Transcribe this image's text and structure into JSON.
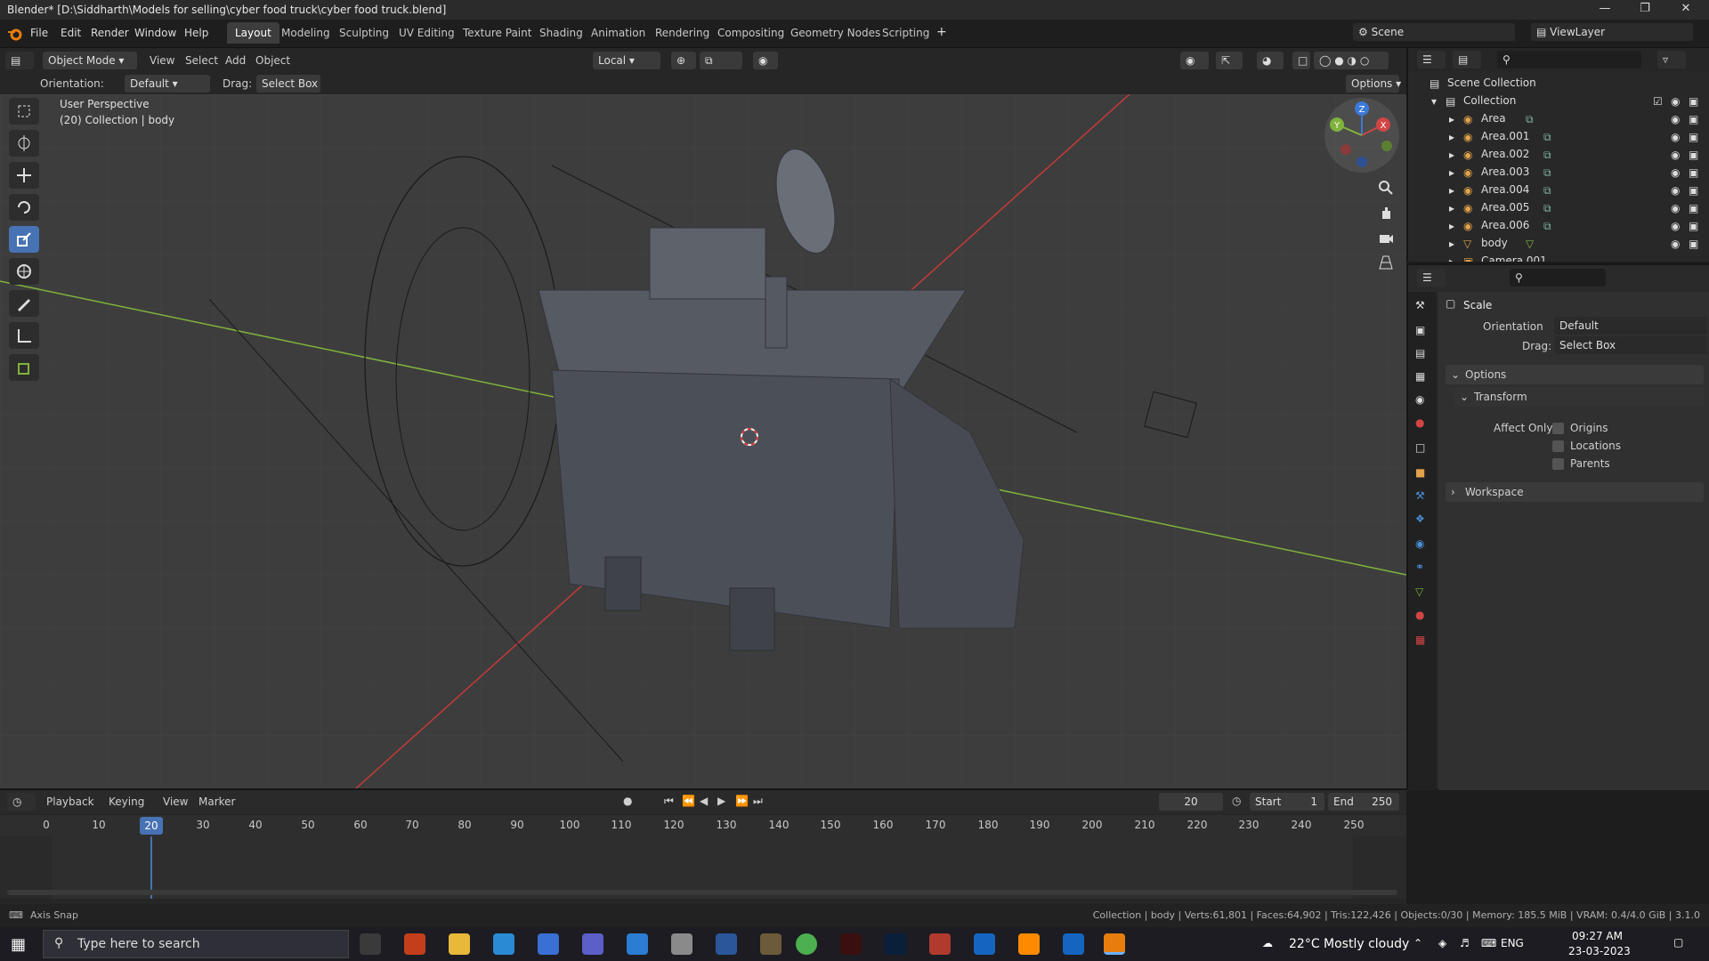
{
  "window": {
    "title": "Blender* [D:\\Siddharth\\Models for selling\\cyber food truck\\cyber food truck.blend]",
    "controls": [
      "minimize-icon",
      "maximize-icon",
      "close-icon"
    ]
  },
  "menubar": {
    "menus": [
      "File",
      "Edit",
      "Render",
      "Window",
      "Help"
    ],
    "workspaces": [
      "Layout",
      "Modeling",
      "Sculpting",
      "UV Editing",
      "Texture Paint",
      "Shading",
      "Animation",
      "Rendering",
      "Compositing",
      "Geometry Nodes",
      "Scripting"
    ],
    "active_workspace": "Layout",
    "add_workspace": "+",
    "scene_label": "Scene",
    "viewlayer_label": "ViewLayer"
  },
  "viewport_header": {
    "mode": "Object Mode",
    "menus": [
      "View",
      "Select",
      "Add",
      "Object"
    ],
    "transform_orientation": "Local",
    "options": "Options"
  },
  "tool_header": {
    "orientation_label": "Orientation:",
    "orientation_value": "Default",
    "drag_label": "Drag:",
    "drag_value": "Select Box"
  },
  "viewport": {
    "view_name": "User Perspective",
    "context": "(20) Collection | body",
    "gizmo_axes": [
      "Z",
      "X",
      "Y"
    ],
    "tools": [
      "select-box-icon",
      "cursor-icon",
      "move-icon",
      "rotate-icon",
      "scale-icon",
      "transform-icon",
      "annotate-icon",
      "measure-icon",
      "add-cube-icon"
    ],
    "active_tool": "scale-icon"
  },
  "outliner": {
    "root": "Scene Collection",
    "collection": "Collection",
    "items": [
      {
        "name": "Area",
        "type": "light"
      },
      {
        "name": "Area.001",
        "type": "light"
      },
      {
        "name": "Area.002",
        "type": "light"
      },
      {
        "name": "Area.003",
        "type": "light"
      },
      {
        "name": "Area.004",
        "type": "light"
      },
      {
        "name": "Area.005",
        "type": "light"
      },
      {
        "name": "Area.006",
        "type": "light"
      },
      {
        "name": "body",
        "type": "mesh"
      },
      {
        "name": "Camera.001",
        "type": "camera"
      }
    ]
  },
  "properties": {
    "tool_name": "Scale",
    "orientation_label": "Orientation",
    "orientation_value": "Default",
    "drag_label": "Drag:",
    "drag_value": "Select Box",
    "options_panel": "Options",
    "transform_panel": "Transform",
    "affect_only_label": "Affect Only",
    "affect_items": [
      "Origins",
      "Locations",
      "Parents"
    ],
    "workspace_panel": "Workspace"
  },
  "timeline": {
    "menus": [
      "Playback",
      "Keying",
      "View",
      "Marker"
    ],
    "current_frame": "20",
    "start_label": "Start",
    "start_value": "1",
    "end_label": "End",
    "end_value": "250",
    "ruler_ticks": [
      "0",
      "10",
      "20",
      "30",
      "40",
      "50",
      "60",
      "70",
      "80",
      "90",
      "100",
      "110",
      "120",
      "130",
      "140",
      "150",
      "160",
      "170",
      "180",
      "190",
      "200",
      "210",
      "220",
      "230",
      "240",
      "250"
    ]
  },
  "statusbar": {
    "left": "Axis Snap",
    "right": "Collection | body | Verts:61,801 | Faces:64,902 | Tris:122,426 | Objects:0/30 | Memory: 185.5 MiB | VRAM: 0.4/4.0 GiB | 3.1.0"
  },
  "taskbar": {
    "search_placeholder": "Type here to search",
    "weather": "22°C  Mostly cloudy",
    "language": "ENG",
    "time": "09:27 AM",
    "date": "23-03-2023"
  },
  "colors": {
    "accent": "#4772b3",
    "x_axis": "#c63a3a",
    "y_axis": "#7fb33b",
    "viewport_bg": "#3d3d3d"
  }
}
